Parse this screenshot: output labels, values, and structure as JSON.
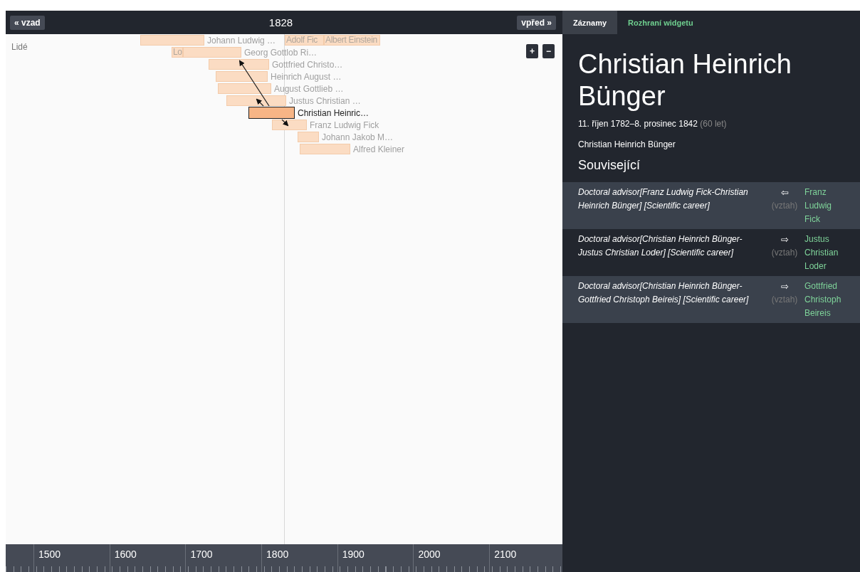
{
  "timeline": {
    "back_button": "« vzad",
    "year": "1828",
    "forward_button": "vpřed »",
    "section_label": "Lidé",
    "zoom_in": "+",
    "zoom_out": "−",
    "people": [
      {
        "label": "Johann Ludwig …",
        "kind": "after",
        "selected": false
      },
      {
        "label": "Adolf Fic",
        "kind": "inside",
        "selected": false
      },
      {
        "label": "Albert Einstein",
        "kind": "inside",
        "selected": false
      },
      {
        "label": "Lo",
        "kind": "inside",
        "selected": false
      },
      {
        "label": "Georg Gottlob Ri…",
        "kind": "after",
        "selected": false
      },
      {
        "label": "Gottfried Christo…",
        "kind": "after",
        "selected": false
      },
      {
        "label": "Heinrich August …",
        "kind": "after",
        "selected": false
      },
      {
        "label": "August Gottlieb …",
        "kind": "after",
        "selected": false
      },
      {
        "label": "Justus Christian …",
        "kind": "after",
        "selected": false
      },
      {
        "label": "Christian Heinric…",
        "kind": "after",
        "selected": true
      },
      {
        "label": "Franz Ludwig Fick",
        "kind": "after",
        "selected": false
      },
      {
        "label": "Johann Jakob M…",
        "kind": "after",
        "selected": false
      },
      {
        "label": "Alfred Kleiner",
        "kind": "after",
        "selected": false
      }
    ],
    "ruler_labels": [
      "1500",
      "1600",
      "1700",
      "1800",
      "1900",
      "2000",
      "2100"
    ]
  },
  "panel": {
    "tabs": [
      {
        "label": "Záznamy",
        "selected": true
      },
      {
        "label": "Rozhraní widgetu",
        "selected": false
      }
    ],
    "title": "Christian Heinrich Bünger",
    "dates": "11. říjen 1782–8. prosinec 1842",
    "age": "(60 let)",
    "name": "Christian Heinrich Bünger",
    "related_heading": "Související",
    "relations": [
      {
        "description": "Doctoral advisor[Franz Ludwig Fick-Christian Heinrich Bünger] [Scientific career]",
        "arrow": "⇦",
        "relation_label": "(vztah)",
        "link": "Franz Ludwig Fick"
      },
      {
        "description": "Doctoral advisor[Christian Heinrich Bünger-Justus Christian Loder] [Scientific career]",
        "arrow": "⇨",
        "relation_label": "(vztah)",
        "link": "Justus Christian Loder"
      },
      {
        "description": "Doctoral advisor[Christian Heinrich Bünger-Gottfried Christoph Beireis] [Scientific career]",
        "arrow": "⇨",
        "relation_label": "(vztah)",
        "link": "Gottfried Christoph Beireis"
      }
    ]
  }
}
